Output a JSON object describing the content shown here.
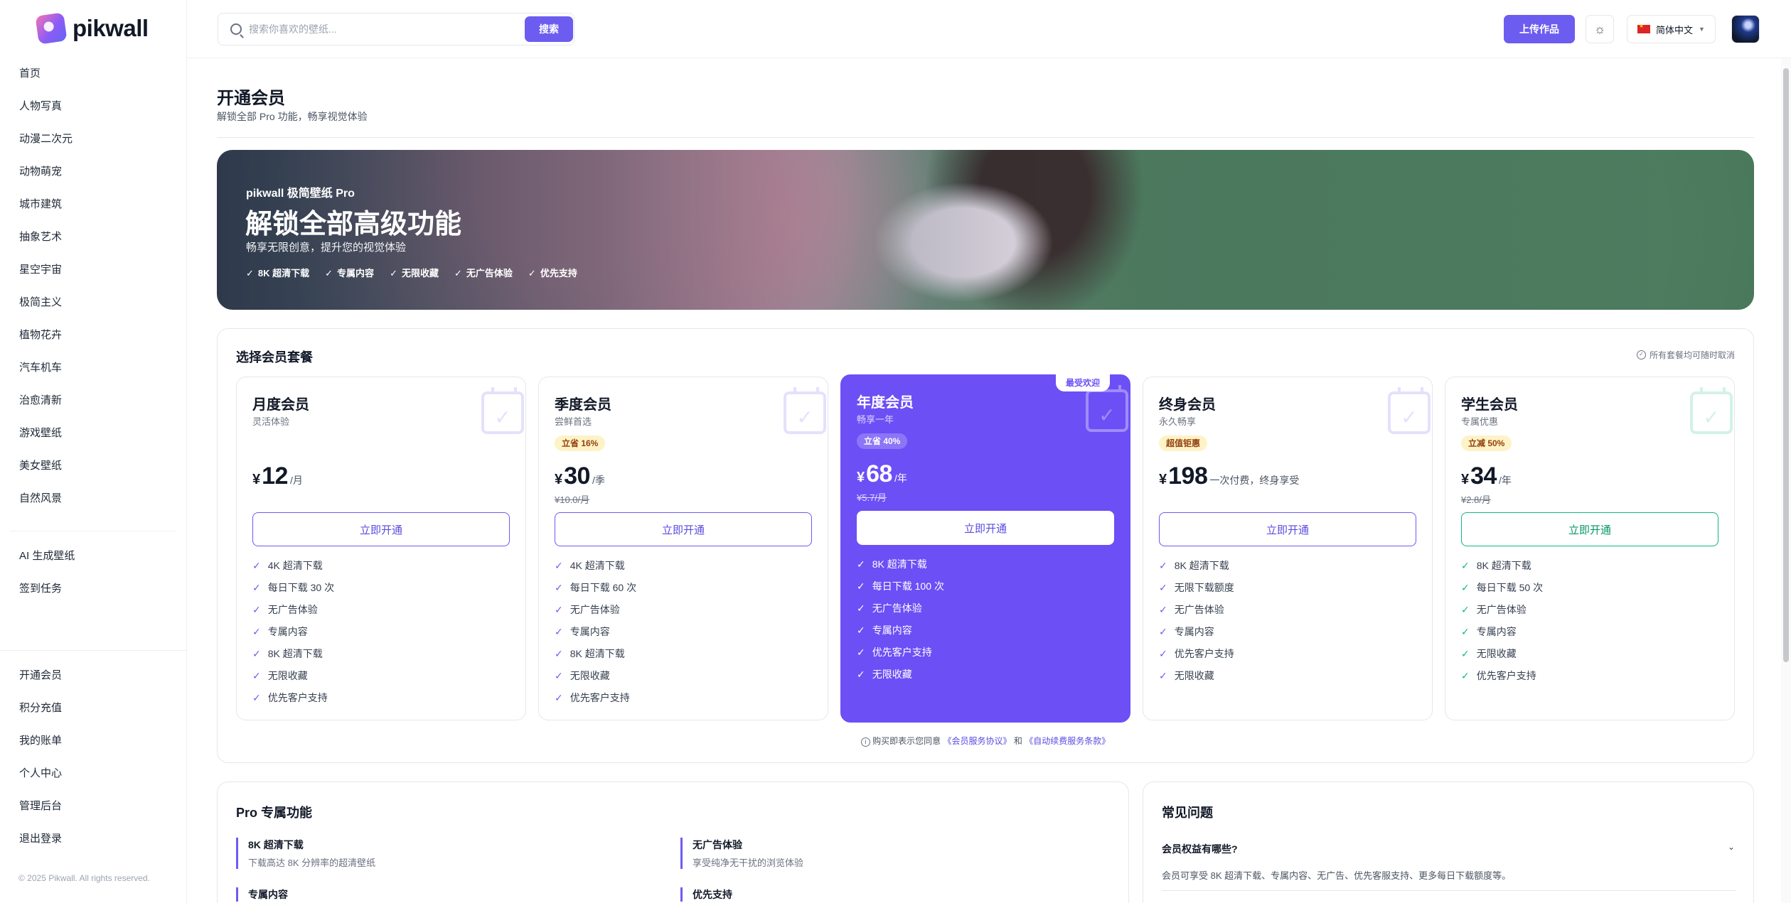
{
  "brand": {
    "name": "pikwall"
  },
  "sidebar": {
    "categories": [
      "首页",
      "人物写真",
      "动漫二次元",
      "动物萌宠",
      "城市建筑",
      "抽象艺术",
      "星空宇宙",
      "极简主义",
      "植物花卉",
      "汽车机车",
      "治愈清新",
      "游戏壁纸",
      "美女壁纸",
      "自然风景"
    ],
    "tools": [
      "AI 生成壁纸",
      "签到任务"
    ],
    "account": [
      "开通会员",
      "积分充值",
      "我的账单",
      "个人中心",
      "管理后台",
      "退出登录"
    ],
    "footer": "© 2025 Pikwall. All rights reserved."
  },
  "header": {
    "search_placeholder": "搜索你喜欢的壁纸...",
    "search_button": "搜索",
    "upload_button": "上传作品",
    "theme_icon": "sun-icon",
    "language": "简体中文"
  },
  "page": {
    "title": "开通会员",
    "subtitle": "解锁全部 Pro 功能，畅享视觉体验"
  },
  "hero": {
    "kicker": "pikwall 极简壁纸 Pro",
    "title": "解锁全部高级功能",
    "subtitle": "畅享无限创意，提升您的视觉体验",
    "features": [
      "8K 超清下载",
      "专属内容",
      "无限收藏",
      "无广告体验",
      "优先支持"
    ]
  },
  "plans_section": {
    "title": "选择会员套餐",
    "note": "所有套餐均可随时取消",
    "currency": "¥",
    "plans": [
      {
        "name": "月度会员",
        "tagline": "灵活体验",
        "badge": "",
        "price": "12",
        "unit": "/月",
        "original": "",
        "button": "立即开通",
        "features": [
          "4K 超清下载",
          "每日下载 30 次",
          "无广告体验",
          "专属内容",
          "8K 超清下载",
          "无限收藏",
          "优先客户支持"
        ]
      },
      {
        "name": "季度会员",
        "tagline": "尝鲜首选",
        "badge": "立省 16%",
        "price": "30",
        "unit": "/季",
        "original": "¥10.0/月",
        "button": "立即开通",
        "features": [
          "4K 超清下载",
          "每日下载 60 次",
          "无广告体验",
          "专属内容",
          "8K 超清下载",
          "无限收藏",
          "优先客户支持"
        ]
      },
      {
        "name": "年度会员",
        "tagline": "畅享一年",
        "badge": "立省 40%",
        "price": "68",
        "unit": "/年",
        "original": "¥5.7/月",
        "button": "立即开通",
        "ribbon": "最受欢迎",
        "features": [
          "8K 超清下载",
          "每日下载 100 次",
          "无广告体验",
          "专属内容",
          "优先客户支持",
          "无限收藏"
        ]
      },
      {
        "name": "终身会员",
        "tagline": "永久畅享",
        "badge": "超值钜惠",
        "price": "198",
        "unit": "一次付费，终身享受",
        "original": "",
        "button": "立即开通",
        "features": [
          "8K 超清下载",
          "无限下载额度",
          "无广告体验",
          "专属内容",
          "优先客户支持",
          "无限收藏"
        ]
      },
      {
        "name": "学生会员",
        "tagline": "专属优惠",
        "badge": "立减 50%",
        "price": "34",
        "unit": "/年",
        "original": "¥2.8/月",
        "button": "立即开通",
        "features": [
          "8K 超清下载",
          "每日下载 50 次",
          "无广告体验",
          "专属内容",
          "无限收藏",
          "优先客户支持"
        ]
      }
    ],
    "agreement": {
      "prefix": "购买即表示您同意",
      "link1": "《会员服务协议》",
      "mid": "和",
      "link2": "《自动续费服务条款》"
    }
  },
  "pro_features": {
    "title": "Pro 专属功能",
    "items": [
      {
        "title": "8K 超清下载",
        "desc": "下载高达 8K 分辨率的超清壁纸"
      },
      {
        "title": "无广告体验",
        "desc": "享受纯净无干扰的浏览体验"
      },
      {
        "title": "专属内容",
        "desc": ""
      },
      {
        "title": "优先支持",
        "desc": ""
      }
    ]
  },
  "faq": {
    "title": "常见问题",
    "items": [
      {
        "q": "会员权益有哪些?",
        "a": "会员可享受 8K 超清下载、专属内容、无广告、优先客服支持、更多每日下载额度等。"
      }
    ]
  },
  "colors": {
    "accent": "#6d5cf0",
    "featured": "#6d4ff6",
    "student": "#10b981",
    "badge_bg": "#fef3c7"
  }
}
